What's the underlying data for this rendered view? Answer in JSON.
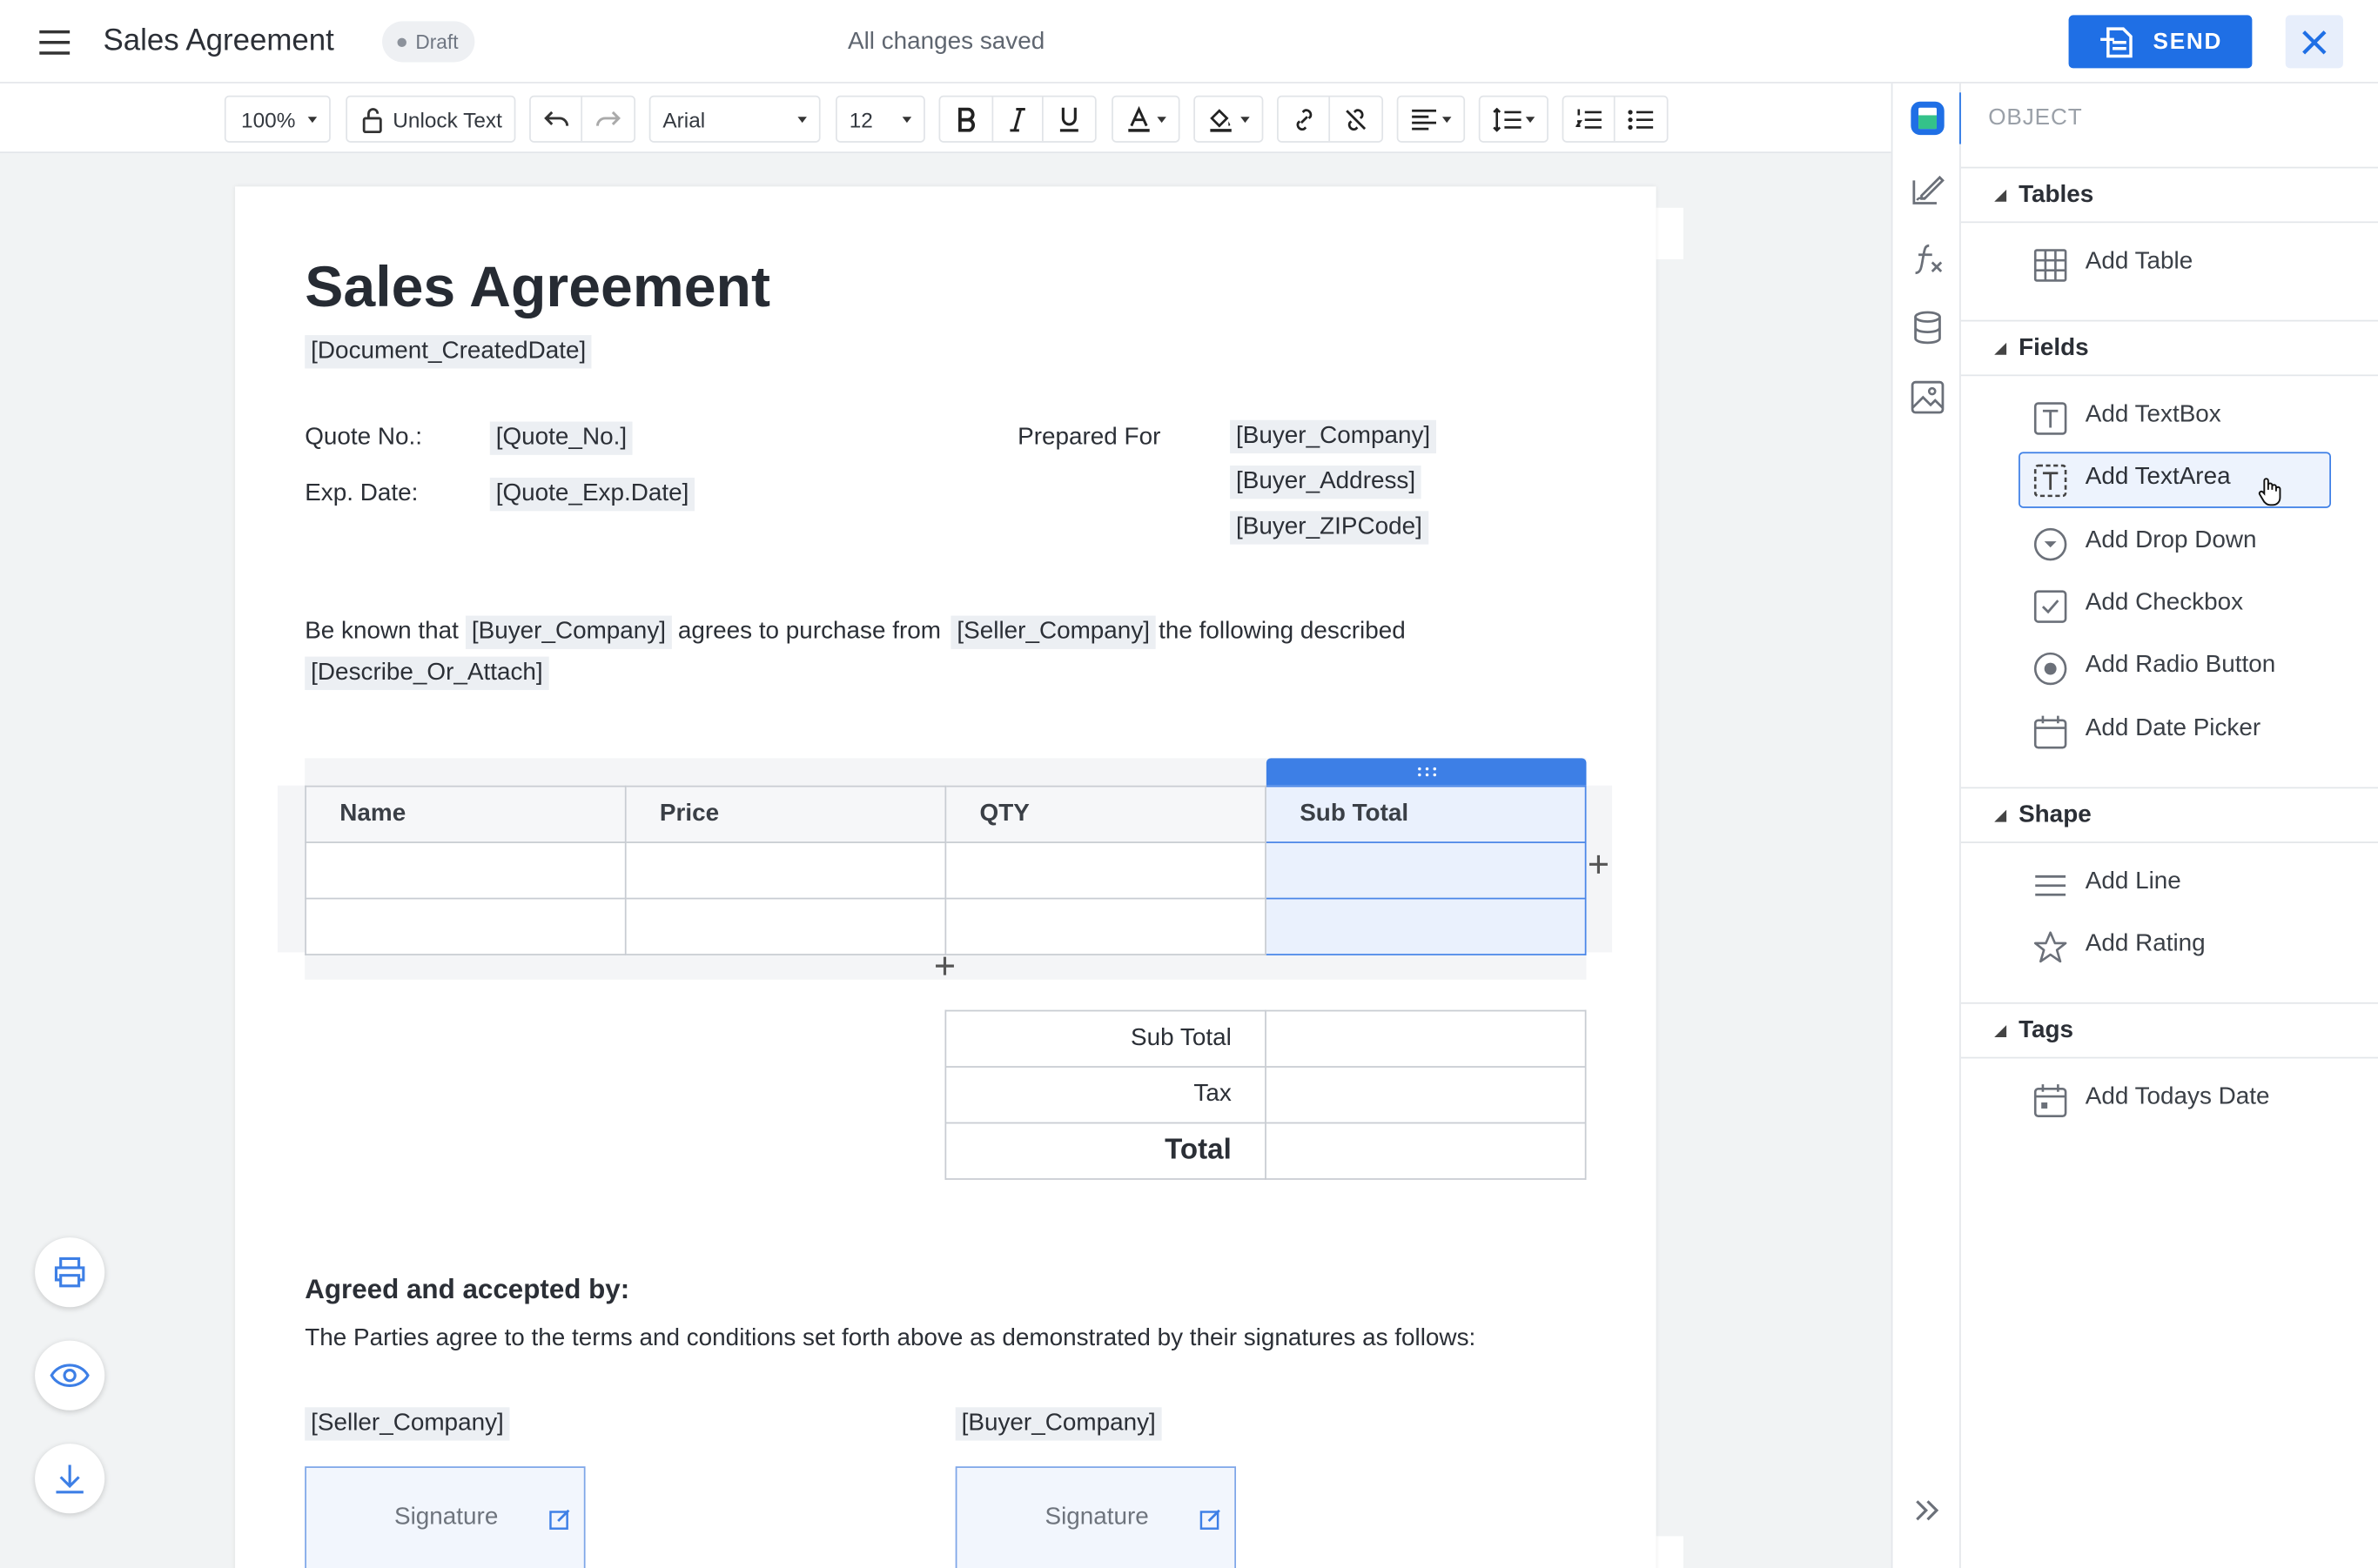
{
  "header": {
    "title": "Sales Agreement",
    "status_badge": "Draft",
    "save_status": "All changes saved",
    "send_label": "SEND"
  },
  "toolbar": {
    "zoom": "100%",
    "unlock_text": "Unlock Text",
    "font_family": "Arial",
    "font_size": "12"
  },
  "document": {
    "title": "Sales Agreement",
    "created_date_tag": "[Document_CreatedDate]",
    "quote_no_label": "Quote No.:",
    "quote_no_tag": "[Quote_No.]",
    "exp_date_label": "Exp. Date:",
    "exp_date_tag": "[Quote_Exp.Date]",
    "prepared_for_label": "Prepared For",
    "buyer_company_tag": "[Buyer_Company]",
    "buyer_address_tag": "[Buyer_Address]",
    "buyer_zip_tag": "[Buyer_ZIPCode]",
    "intro": {
      "part1": "Be known that",
      "tag1": "[Buyer_Company]",
      "part2": "agrees to purchase from",
      "tag2": "[Seller_Company]",
      "part3": "the following described",
      "tag3": "[Describe_Or_Attach]"
    },
    "items_table": {
      "headers": [
        "Name",
        "Price",
        "QTY",
        "Sub Total"
      ],
      "rows": [
        [
          "",
          "",
          "",
          ""
        ],
        [
          "",
          "",
          "",
          ""
        ]
      ]
    },
    "totals": {
      "subtotal_label": "Sub Total",
      "tax_label": "Tax",
      "total_label": "Total"
    },
    "agreed_heading": "Agreed and accepted by:",
    "agreed_text": "The Parties agree to the terms and conditions set forth above as demonstrated by their signatures as follows:",
    "seller_tag": "[Seller_Company]",
    "buyer_tag": "[Buyer_Company]",
    "signature_label": "Signature"
  },
  "panel": {
    "title": "OBJECT",
    "sections": {
      "tables": {
        "title": "Tables",
        "items": [
          {
            "label": "Add Table",
            "icon": "table-icon"
          }
        ]
      },
      "fields": {
        "title": "Fields",
        "items": [
          {
            "label": "Add TextBox",
            "icon": "textbox-icon"
          },
          {
            "label": "Add TextArea",
            "icon": "textarea-icon"
          },
          {
            "label": "Add Drop Down",
            "icon": "dropdown-icon"
          },
          {
            "label": "Add Checkbox",
            "icon": "checkbox-icon"
          },
          {
            "label": "Add Radio Button",
            "icon": "radio-icon"
          },
          {
            "label": "Add Date Picker",
            "icon": "calendar-icon"
          }
        ]
      },
      "shape": {
        "title": "Shape",
        "items": [
          {
            "label": "Add Line",
            "icon": "line-icon"
          },
          {
            "label": "Add Rating",
            "icon": "star-icon"
          }
        ]
      },
      "tags": {
        "title": "Tags",
        "items": [
          {
            "label": "Add Todays Date",
            "icon": "calendar-today-icon"
          }
        ]
      }
    }
  },
  "colors": {
    "accent": "#1f6fe5",
    "selection": "#4a86e8",
    "tag_background": "#eceff3"
  }
}
